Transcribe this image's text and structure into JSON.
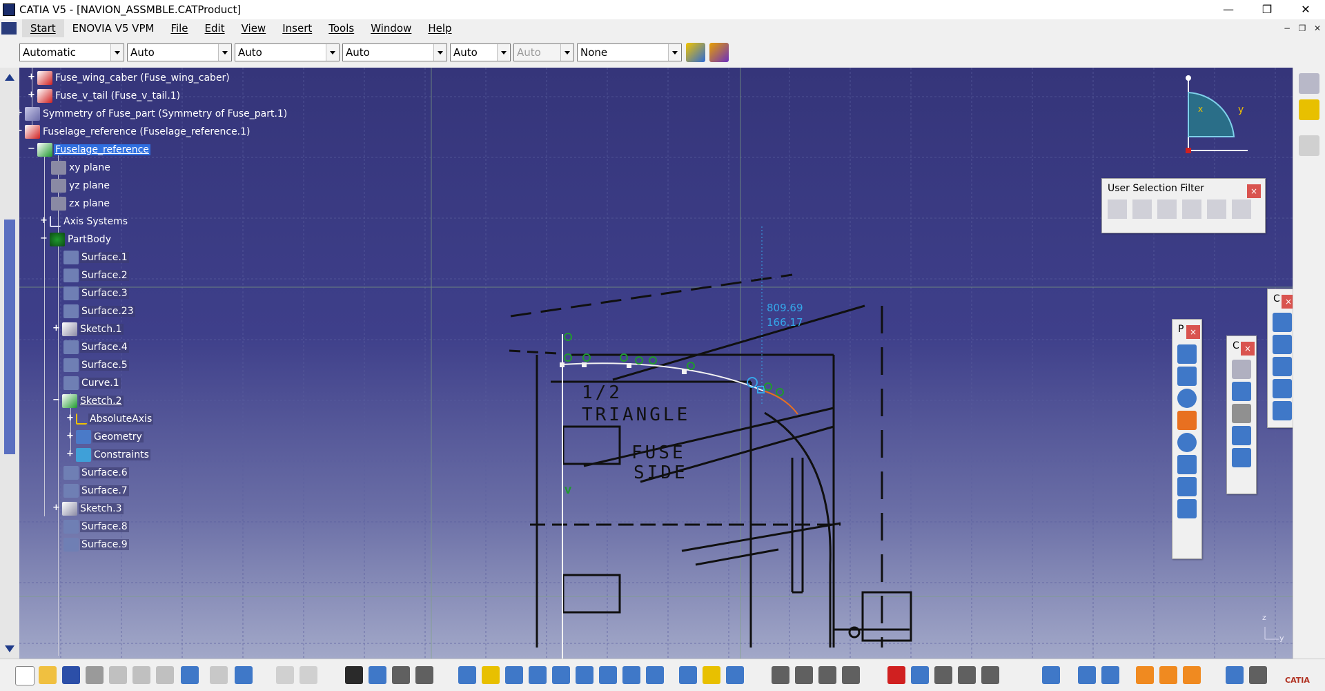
{
  "window": {
    "title": "CATIA V5 - [NAVION_ASSMBLE.CATProduct]",
    "minimize": "—",
    "restore": "❐",
    "close": "✕"
  },
  "menu": {
    "items": [
      "Start",
      "ENOVIA V5 VPM",
      "File",
      "Edit",
      "View",
      "Insert",
      "Tools",
      "Window",
      "Help"
    ],
    "mdi": [
      "−",
      "❐",
      "✕"
    ]
  },
  "toolbar": {
    "combos": [
      "Automatic",
      "Auto",
      "Auto",
      "Auto",
      "Auto",
      "Auto",
      "None"
    ]
  },
  "tree": {
    "nodes": [
      {
        "label": "Fuse_wing_caber (Fuse_wing_caber)"
      },
      {
        "label": "Fuse_v_tail (Fuse_v_tail.1)"
      },
      {
        "label": "Symmetry of Fuse_part (Symmetry of Fuse_part.1)"
      },
      {
        "label": "Fuselage_reference (Fuselage_reference.1)"
      },
      {
        "label": "Fuselage_reference"
      },
      {
        "label": "xy plane"
      },
      {
        "label": "yz plane"
      },
      {
        "label": "zx plane"
      },
      {
        "label": "Axis Systems"
      },
      {
        "label": "PartBody"
      },
      {
        "label": "Surface.1"
      },
      {
        "label": "Surface.2"
      },
      {
        "label": "Surface.3"
      },
      {
        "label": "Surface.23"
      },
      {
        "label": "Sketch.1"
      },
      {
        "label": "Surface.4"
      },
      {
        "label": "Surface.5"
      },
      {
        "label": "Curve.1"
      },
      {
        "label": "Sketch.2"
      },
      {
        "label": "AbsoluteAxis"
      },
      {
        "label": "Geometry"
      },
      {
        "label": "Constraints"
      },
      {
        "label": "Surface.6"
      },
      {
        "label": "Surface.7"
      },
      {
        "label": "Sketch.3"
      },
      {
        "label": "Surface.8"
      },
      {
        "label": "Surface.9"
      }
    ]
  },
  "sketch": {
    "coord_x": "809.69",
    "coord_y": "166.17",
    "text1": "1/2",
    "text2": "TRIANGLE",
    "text3": "FUSE",
    "text4": "SIDE",
    "v_label": "V"
  },
  "compass": {
    "z": "z",
    "x": "x",
    "y": "y"
  },
  "axis_mini": {
    "z": "z",
    "y": "y"
  },
  "floatbars": {
    "user_selection_filter": {
      "title": "User Selection Filter",
      "close": "×"
    },
    "profile": {
      "title": "P",
      "close": "×"
    },
    "constraint": {
      "title": "C",
      "close": "×"
    },
    "operation": {
      "title": "C",
      "close": "×"
    }
  },
  "brand": {
    "catia": "CATIA"
  },
  "colors": {
    "viewport_top": "#35357a",
    "viewport_bottom": "#a2a8c8",
    "selection": "#2f6fe0",
    "close_red": "#d9534f",
    "coord": "#35a6e8"
  }
}
